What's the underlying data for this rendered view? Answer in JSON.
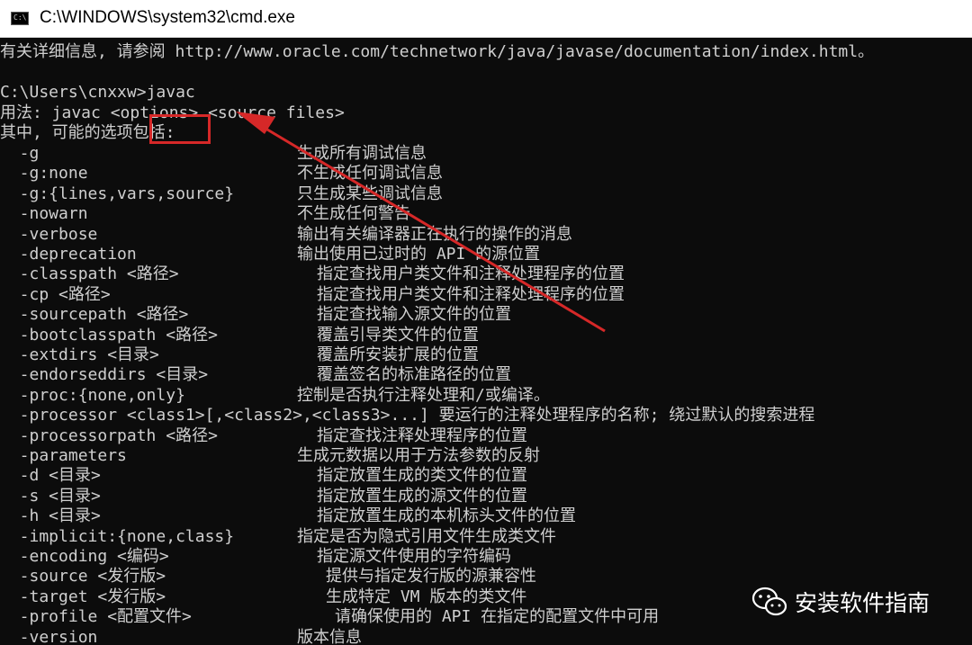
{
  "window": {
    "title": "C:\\WINDOWS\\system32\\cmd.exe",
    "icon_glyph": "C:\\"
  },
  "console": {
    "intro_line": "有关详细信息, 请参阅 http://www.oracle.com/technetwork/java/javase/documentation/index.html。",
    "prompt": "C:\\Users\\cnxxw",
    "command": "javac",
    "usage_line": "用法: javac <options> <source files>",
    "options_header": "其中, 可能的选项包括:",
    "options": [
      {
        "flag": "  -g",
        "desc": "生成所有调试信息"
      },
      {
        "flag": "  -g:none",
        "desc": "不生成任何调试信息"
      },
      {
        "flag": "  -g:{lines,vars,source}",
        "desc": "只生成某些调试信息"
      },
      {
        "flag": "  -nowarn",
        "desc": "不生成任何警告"
      },
      {
        "flag": "  -verbose",
        "desc": "输出有关编译器正在执行的操作的消息"
      },
      {
        "flag": "  -deprecation",
        "desc": "输出使用已过时的 API 的源位置"
      },
      {
        "flag": "  -classpath <路径>",
        "desc": "指定查找用户类文件和注释处理程序的位置"
      },
      {
        "flag": "  -cp <路径>",
        "desc": "指定查找用户类文件和注释处理程序的位置"
      },
      {
        "flag": "  -sourcepath <路径>",
        "desc": "指定查找输入源文件的位置"
      },
      {
        "flag": "  -bootclasspath <路径>",
        "desc": "覆盖引导类文件的位置"
      },
      {
        "flag": "  -extdirs <目录>",
        "desc": "覆盖所安装扩展的位置"
      },
      {
        "flag": "  -endorseddirs <目录>",
        "desc": "覆盖签名的标准路径的位置"
      },
      {
        "flag": "  -proc:{none,only}",
        "desc": "控制是否执行注释处理和/或编译。"
      },
      {
        "flag": "  -processor <class1>[,<class2>,<class3>...] 要运行的注释处理程序的名称; 绕过默认的搜索进程",
        "desc": ""
      },
      {
        "flag": "  -processorpath <路径>",
        "desc": "指定查找注释处理程序的位置"
      },
      {
        "flag": "  -parameters",
        "desc": "生成元数据以用于方法参数的反射"
      },
      {
        "flag": "  -d <目录>",
        "desc": "指定放置生成的类文件的位置"
      },
      {
        "flag": "  -s <目录>",
        "desc": "指定放置生成的源文件的位置"
      },
      {
        "flag": "  -h <目录>",
        "desc": "指定放置生成的本机标头文件的位置"
      },
      {
        "flag": "  -implicit:{none,class}",
        "desc": "指定是否为隐式引用文件生成类文件"
      },
      {
        "flag": "  -encoding <编码>",
        "desc": "指定源文件使用的字符编码"
      },
      {
        "flag": "  -source <发行版>",
        "desc": "提供与指定发行版的源兼容性"
      },
      {
        "flag": "  -target <发行版>",
        "desc": "生成特定 VM 版本的类文件"
      },
      {
        "flag": "  -profile <配置文件>",
        "desc": "请确保使用的 API 在指定的配置文件中可用"
      },
      {
        "flag": "  -version",
        "desc": "版本信息"
      }
    ]
  },
  "watermark": {
    "text": "安装软件指南",
    "icon": "wechat-icon"
  },
  "colors": {
    "console_bg": "#0c0c0c",
    "console_text": "#cfcfcf",
    "annotation_red": "#d62828"
  }
}
